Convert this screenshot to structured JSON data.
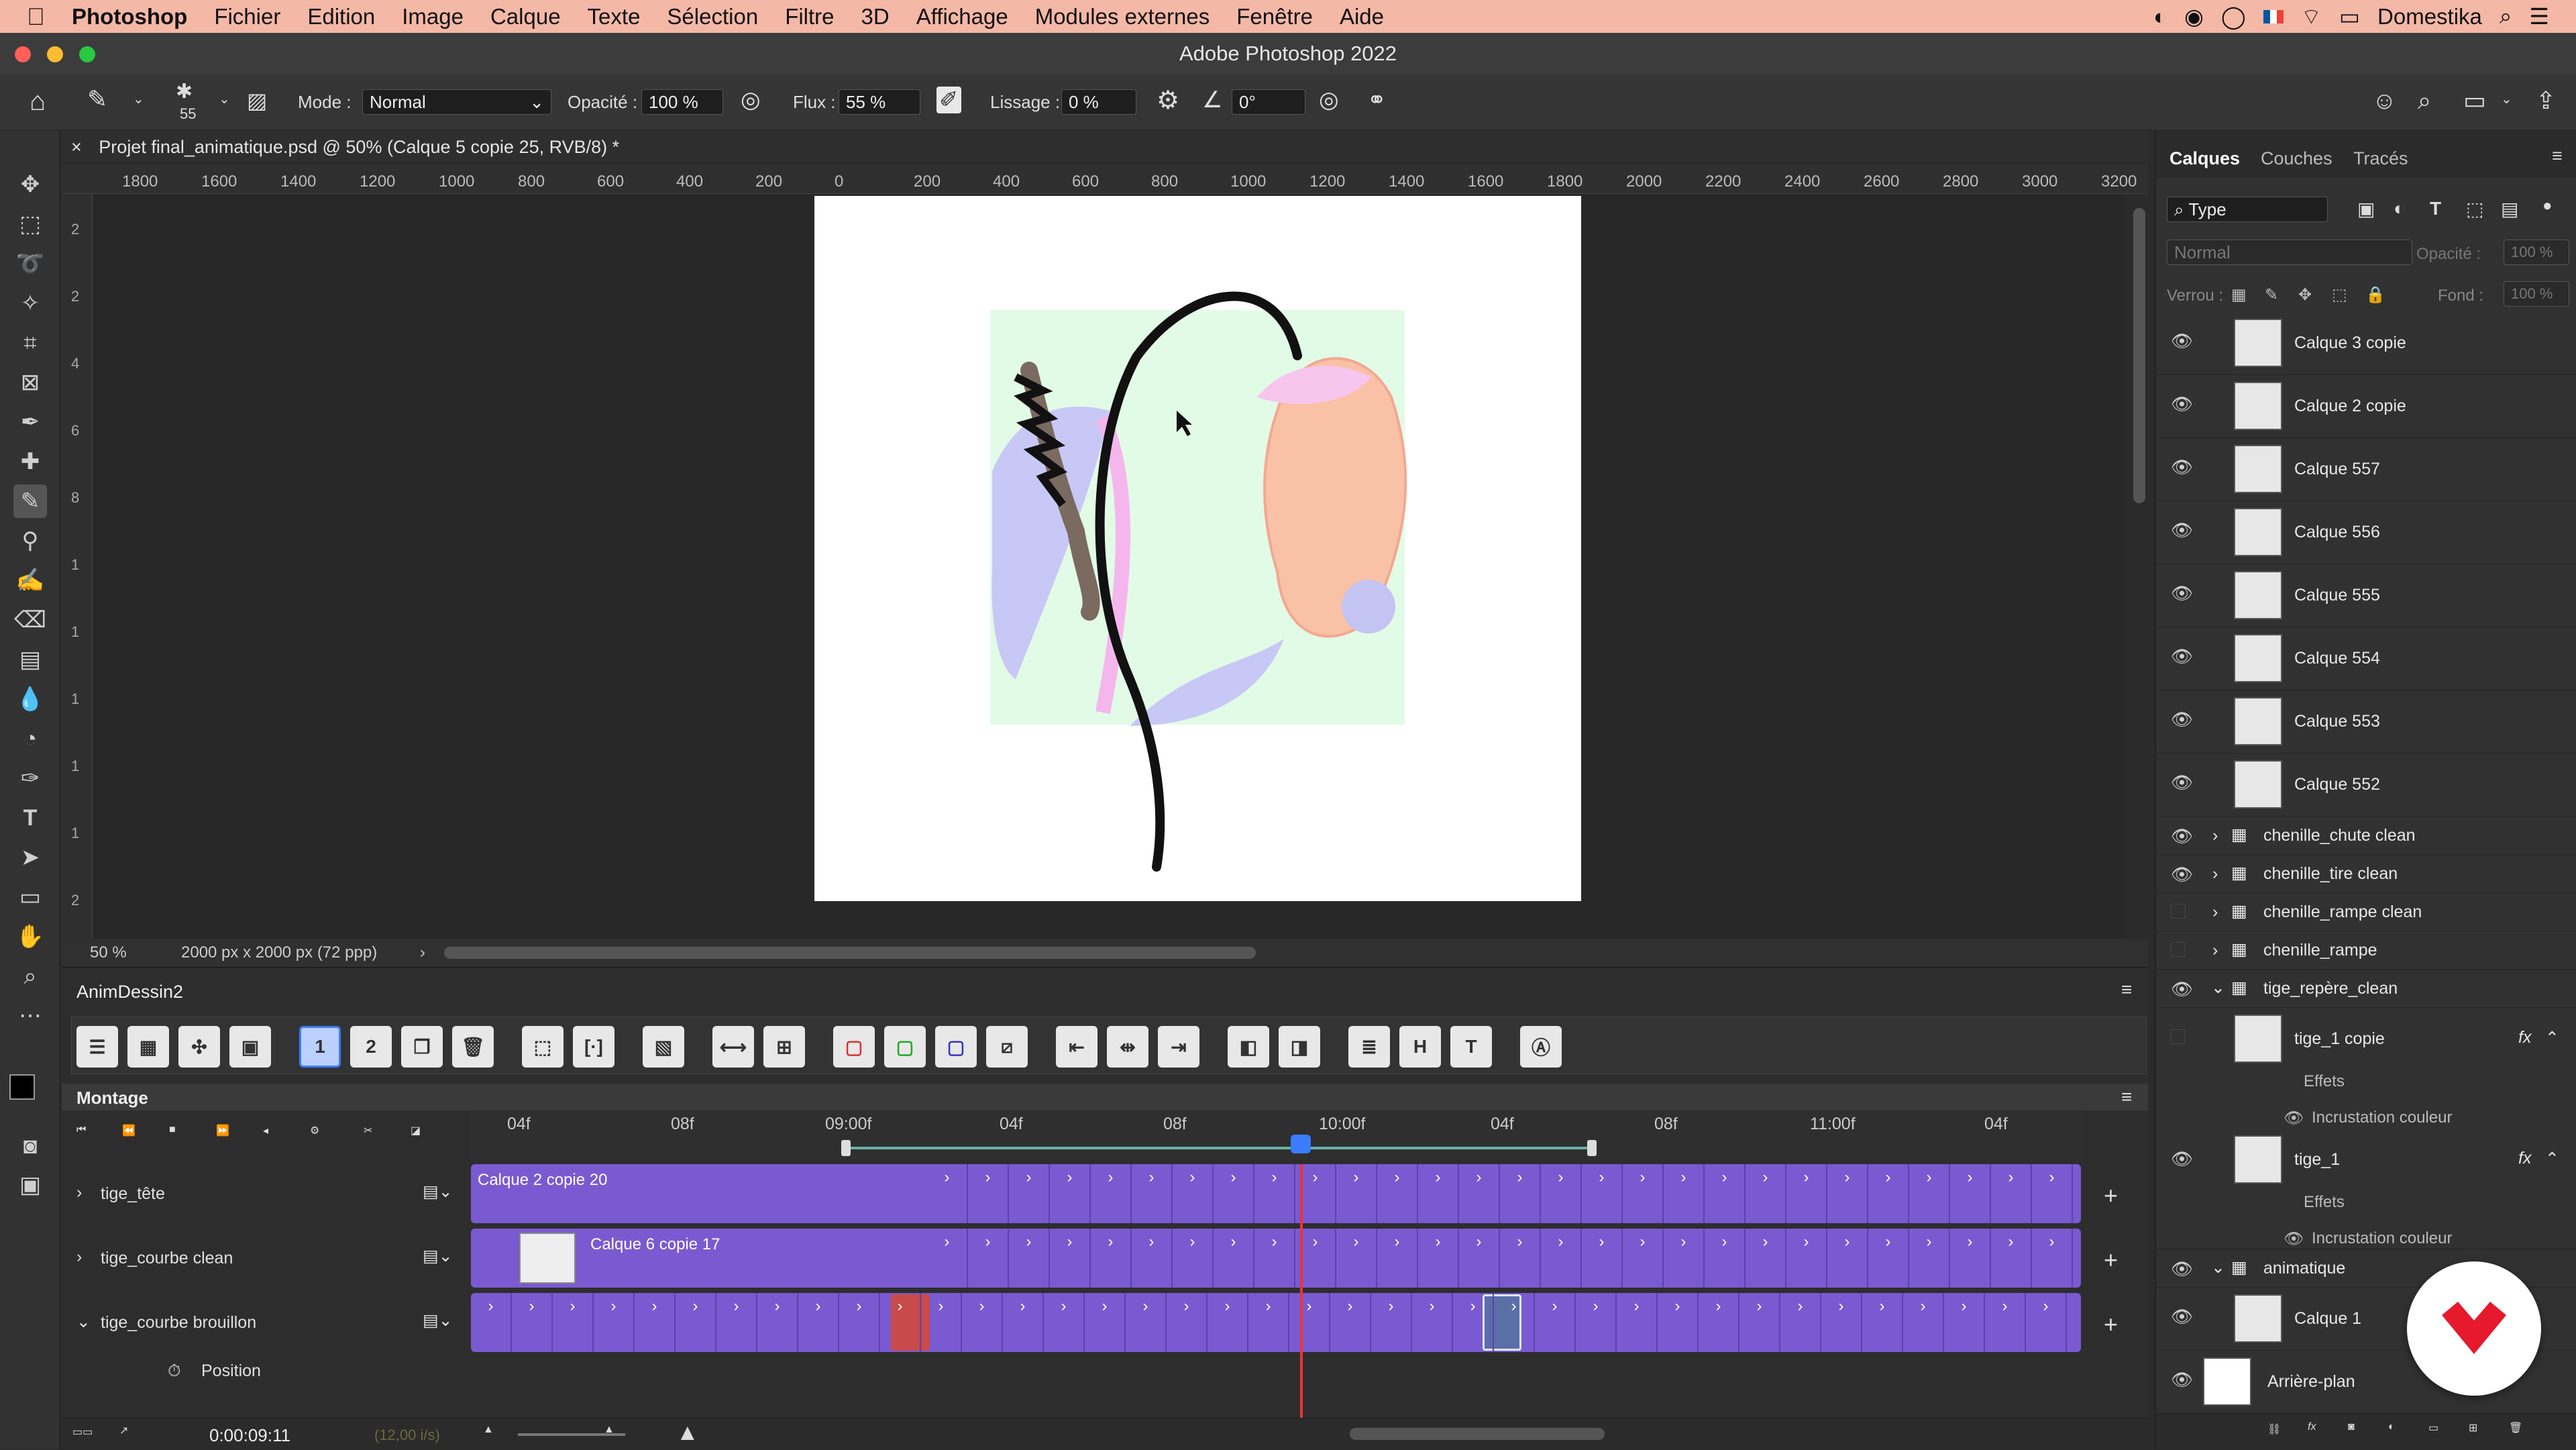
{
  "menubar": {
    "apple": "",
    "app": "Photoshop",
    "items": [
      "Fichier",
      "Edition",
      "Image",
      "Calque",
      "Texte",
      "Sélection",
      "Filtre",
      "3D",
      "Affichage",
      "Modules externes",
      "Fenêtre",
      "Aide"
    ],
    "right_user": "Domestika"
  },
  "window": {
    "title": "Adobe Photoshop 2022"
  },
  "options": {
    "brush_size": "55",
    "mode_label": "Mode :",
    "mode_value": "Normal",
    "opacity_label": "Opacité :",
    "opacity_value": "100 %",
    "flux_label": "Flux :",
    "flux_value": "55 %",
    "lissage_label": "Lissage :",
    "lissage_value": "0 %",
    "angle_value": "0°"
  },
  "document": {
    "tab_title": "Projet final_animatique.psd @ 50% (Calque 5 copie 25, RVB/8) *",
    "ruler_h": [
      "1800",
      "1600",
      "1400",
      "1200",
      "1000",
      "800",
      "600",
      "400",
      "200",
      "0",
      "200",
      "400",
      "600",
      "800",
      "1000",
      "1200",
      "1400",
      "1600",
      "1800",
      "2000",
      "2200",
      "2400",
      "2600",
      "2800",
      "3000",
      "3200"
    ],
    "ruler_v": [
      "2",
      "2",
      "4",
      "6",
      "8",
      "1",
      "1",
      "1",
      "1",
      "1",
      "2"
    ],
    "zoom": "50 %",
    "size": "2000 px x 2000 px (72 ppp)"
  },
  "timeline": {
    "panel_title": "AnimDessin2",
    "montage": "Montage",
    "ruler_labels": [
      "04f",
      "08f",
      "09:00f",
      "04f",
      "08f",
      "10:00f",
      "04f",
      "08f",
      "11:00f",
      "04f"
    ],
    "tracks": [
      {
        "name": "tige_tête",
        "clip": "Calque 2 copie 20"
      },
      {
        "name": "tige_courbe clean",
        "clip": "Calque 6 copie 17"
      },
      {
        "name": "tige_courbe brouillon",
        "clip": ""
      }
    ],
    "sub_property": "Position",
    "timecode": "0:00:09:11",
    "fps": "(12,00 i/s)"
  },
  "layers_panel": {
    "tabs": [
      "Calques",
      "Couches",
      "Tracés"
    ],
    "filter": "Type",
    "blend": "Normal",
    "opacity_label": "Opacité :",
    "opacity_value": "100 %",
    "lock_label": "Verrou :",
    "fill_label": "Fond :",
    "fill_value": "100 %",
    "frames": [
      "Calque 3 copie",
      "Calque 2 copie",
      "Calque 557",
      "Calque 556",
      "Calque 555",
      "Calque 554",
      "Calque 553",
      "Calque 552"
    ],
    "groups": [
      "chenille_chute clean",
      "chenille_tire clean",
      "chenille_rampe clean",
      "chenille_rampe",
      "tige_repère_clean"
    ],
    "tige1copie": "tige_1 copie",
    "effects": "Effets",
    "incrustation": "Incrustation couleur",
    "tige1": "tige_1",
    "animatique": "animatique",
    "calque1": "Calque 1",
    "background": "Arrière-plan"
  },
  "colors": {
    "accent": "#7a5ad0",
    "menubar": "#f4b8a6",
    "domestika_red": "#e6192d"
  }
}
